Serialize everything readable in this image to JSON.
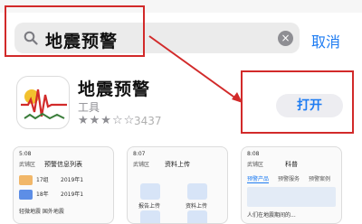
{
  "search": {
    "query": "地震预警",
    "cancel_label": "取消"
  },
  "app": {
    "name": "地震预警",
    "category": "工具",
    "stars": "★★★☆☆",
    "rating_count": "3437",
    "action_label": "打开"
  },
  "screenshots": [
    {
      "time": "5:08",
      "title": "预警信息列表",
      "left": "武铺区",
      "items": [
        {
          "num": "17组",
          "text": "2019年1"
        },
        {
          "num": "18年",
          "text": "2019年1"
        }
      ],
      "bottom": "轻微地震   国外地震"
    },
    {
      "time": "8:07",
      "title": "资料上传",
      "left": "武铺区",
      "tiles": [
        "报告上传",
        "资料上传",
        "统计信息",
        "系统更新"
      ]
    },
    {
      "time": "8:08",
      "title": "科普",
      "left": "武铺区",
      "tabs": [
        "预警产品",
        "预警服务",
        "预警案例"
      ],
      "caption": "人们在地震期间的..."
    }
  ],
  "colors": {
    "accent": "#1e7cf2",
    "highlight": "#d22a2a"
  }
}
